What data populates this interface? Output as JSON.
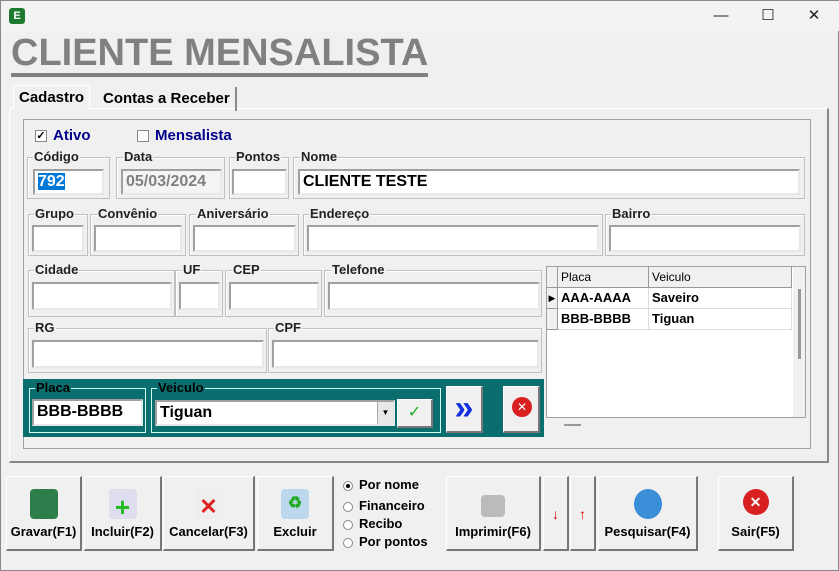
{
  "window": {
    "icon_letter": "E",
    "minimize": "—",
    "maximize": "☐",
    "close": "✕"
  },
  "header": {
    "title": "CLIENTE MENSALISTA"
  },
  "tabs": [
    {
      "label": "Cadastro"
    },
    {
      "label": "Contas a Receber"
    }
  ],
  "checkboxes": {
    "ativo": {
      "label": "Ativo",
      "checked": true
    },
    "mensalista": {
      "label": "Mensalista",
      "checked": false
    }
  },
  "fields": {
    "codigo": {
      "label": "Código",
      "value": "792"
    },
    "data": {
      "label": "Data",
      "value": "05/03/2024"
    },
    "pontos": {
      "label": "Pontos",
      "value": ""
    },
    "nome": {
      "label": "Nome",
      "value": "CLIENTE TESTE"
    },
    "grupo": {
      "label": "Grupo",
      "value": ""
    },
    "convenio": {
      "label": "Convênio",
      "value": ""
    },
    "aniversario": {
      "label": "Aniversário",
      "value": ""
    },
    "endereco": {
      "label": "Endereço",
      "value": ""
    },
    "bairro": {
      "label": "Bairro",
      "value": ""
    },
    "cidade": {
      "label": "Cidade",
      "value": ""
    },
    "uf": {
      "label": "UF",
      "value": ""
    },
    "cep": {
      "label": "CEP",
      "value": ""
    },
    "telefone": {
      "label": "Telefone",
      "value": ""
    },
    "rg": {
      "label": "RG",
      "value": ""
    },
    "cpf": {
      "label": "CPF",
      "value": ""
    }
  },
  "vehicle_panel": {
    "placa_label": "Placa",
    "placa_value": "BBB-BBBB",
    "veiculo_label": "Veiculo",
    "veiculo_value": "Tiguan",
    "add_glyph": "»"
  },
  "grid": {
    "columns": [
      "Placa",
      "Veiculo"
    ],
    "rows": [
      [
        "AAA-AAAA",
        "Saveiro"
      ],
      [
        "BBB-BBBB",
        "Tiguan"
      ]
    ]
  },
  "buttons": {
    "gravar": "Gravar(F1)",
    "incluir": "Incluir(F2)",
    "cancelar": "Cancelar(F3)",
    "excluir": "Excluir",
    "imprimir": "Imprimir(F6)",
    "pesquisar": "Pesquisar(F4)",
    "sair": "Sair(F5)"
  },
  "radios": [
    {
      "label": "Por nome",
      "checked": true
    },
    {
      "label": "Financeiro",
      "checked": false
    },
    {
      "label": "Recibo",
      "checked": false
    },
    {
      "label": "Por pontos",
      "checked": false
    }
  ],
  "colors": {
    "teal": "#0b6e6e",
    "header_gray": "#808080",
    "label_blue": "#00008b"
  }
}
